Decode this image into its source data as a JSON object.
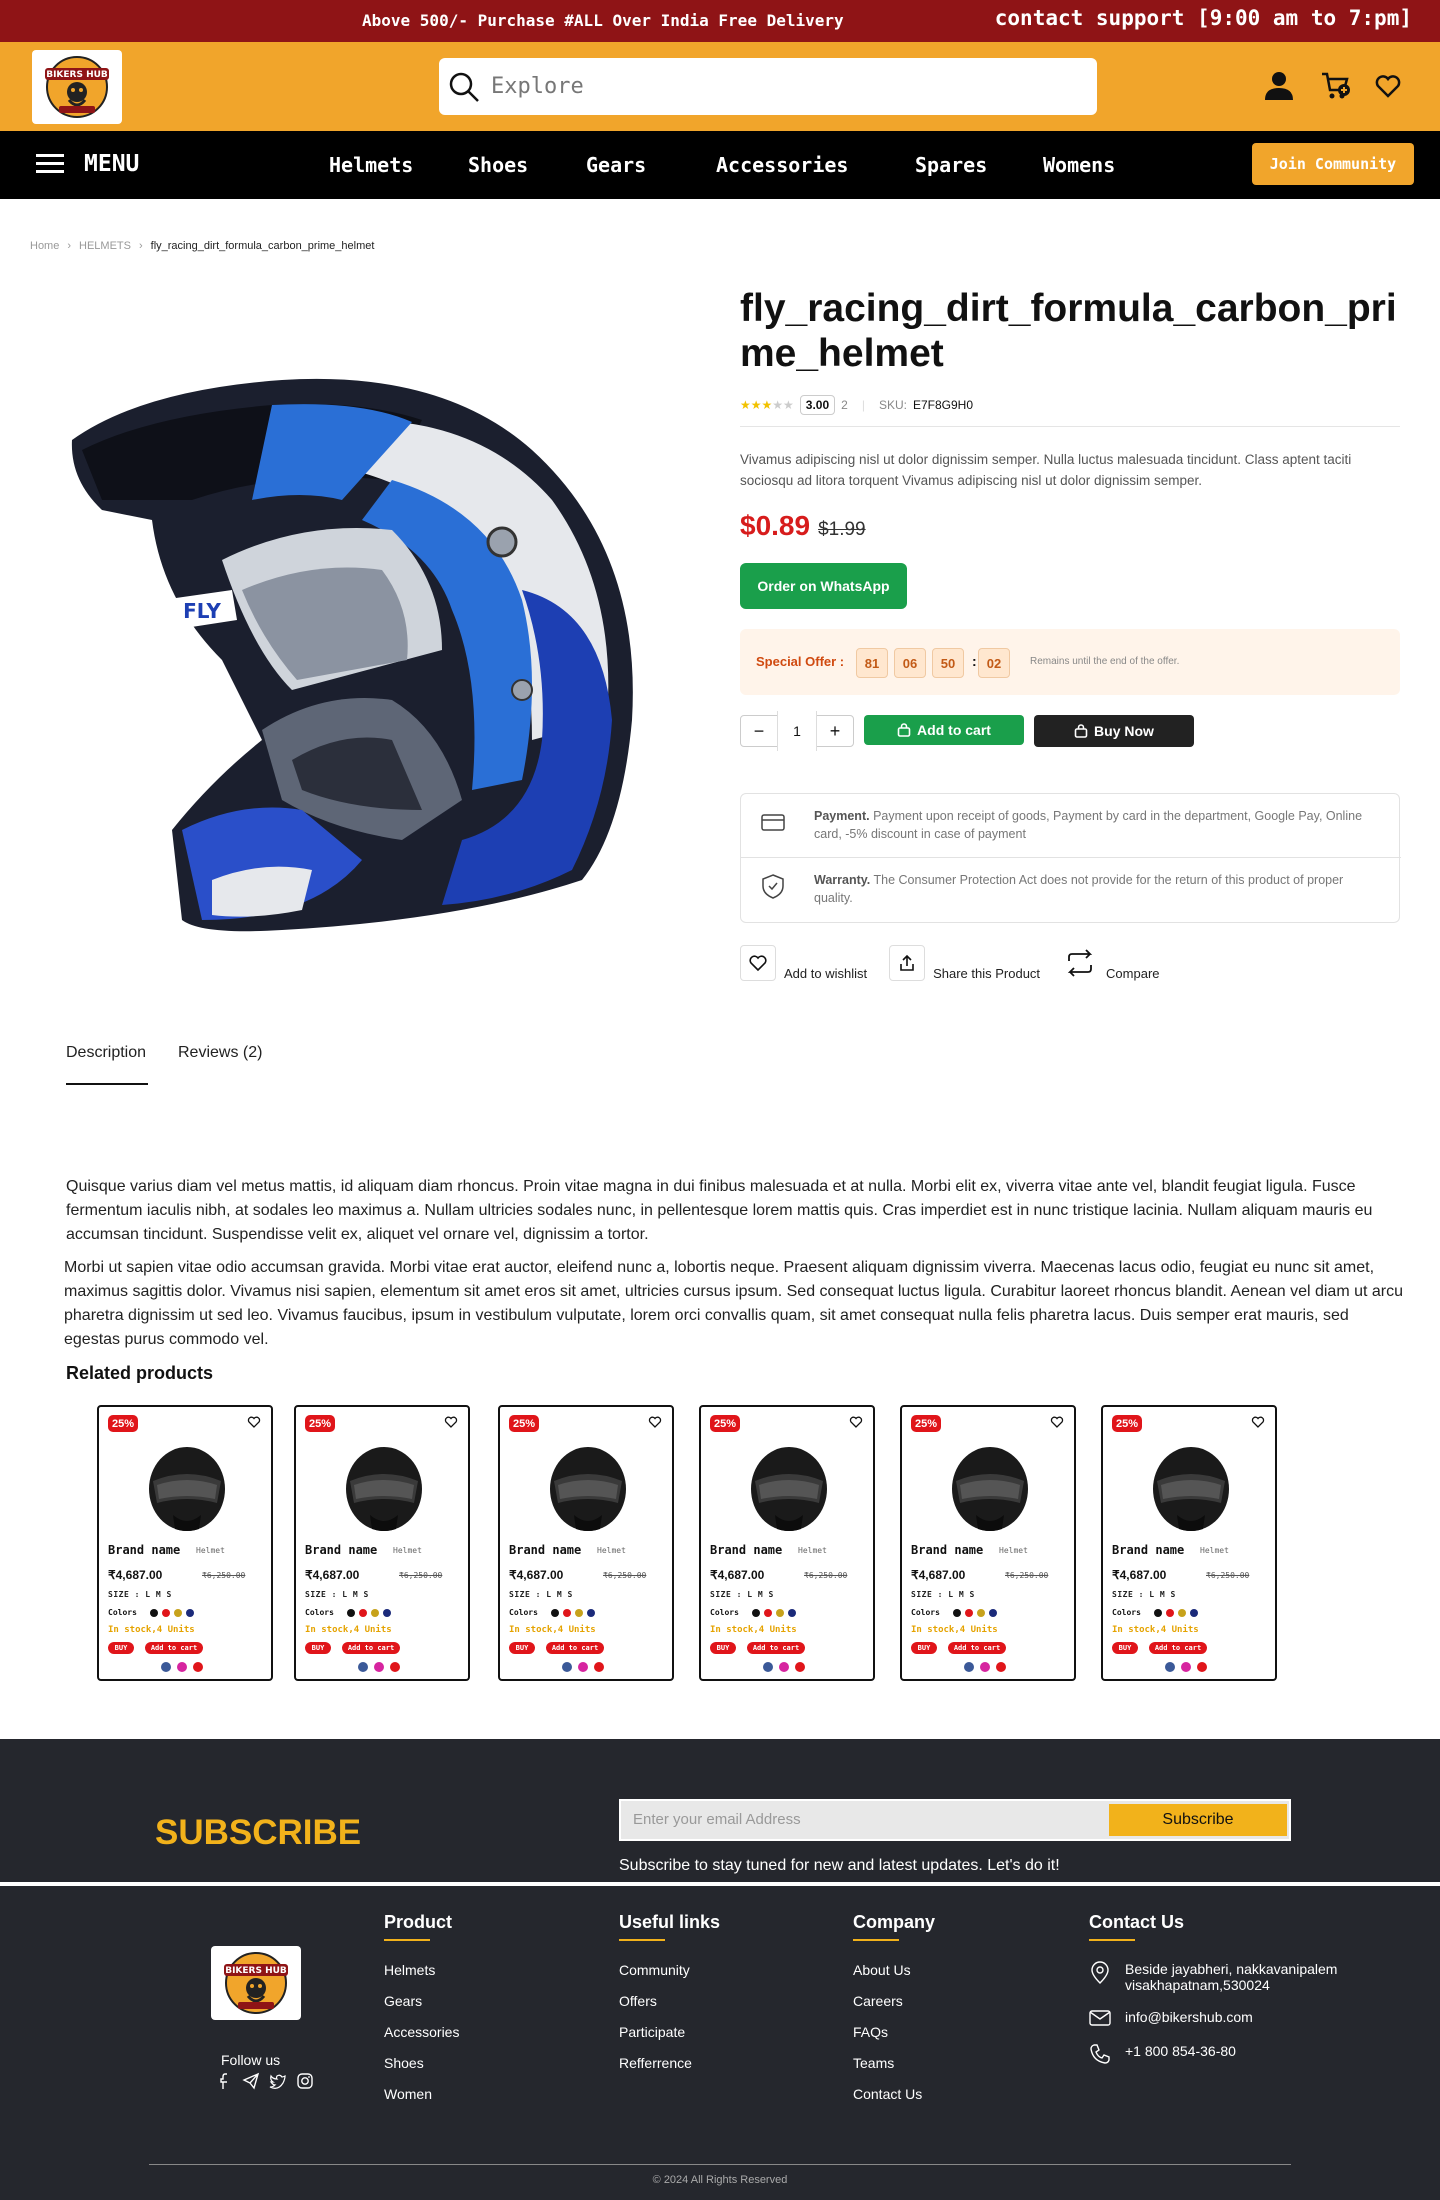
{
  "topbar": {
    "promo": "Above 500/- Purchase  #ALL Over India Free Delivery",
    "support": "contact support [9:00 am to 7:pm]"
  },
  "header": {
    "logo_text": "BIKERS HUB",
    "search_placeholder": "Explore",
    "icons": [
      "user-icon",
      "cart-icon",
      "heart-icon"
    ]
  },
  "nav": {
    "menu_label": "MENU",
    "links": [
      "Helmets",
      "Shoes",
      "Gears",
      "Accessories",
      "Spares",
      "Womens"
    ],
    "join_label": "Join Community"
  },
  "breadcrumb": [
    "Home",
    "HELMETS",
    "fly_racing_dirt_formula_carbon_prime_helmet"
  ],
  "product": {
    "title": "fly_racing_dirt_formula_carbon_prime_helmet",
    "rating_stars": 3,
    "rating_value": "3.00",
    "review_count": "2",
    "sku_label": "SKU:",
    "sku": "E7F8G9H0",
    "description": "Vivamus adipiscing nisl ut dolor dignissim semper. Nulla luctus malesuada tincidunt. Class aptent taciti sociosqu ad litora torquent Vivamus adipiscing nisl ut dolor dignissim semper.",
    "price": "$0.89",
    "old_price": "$1.99",
    "whatsapp_label": "Order on WhatsApp",
    "offer": {
      "label": "Special Offer :",
      "timer": [
        "81",
        "06",
        "50",
        "02"
      ],
      "remains": "Remains until the end of the offer."
    },
    "quantity": "1",
    "add_to_cart": "Add to cart",
    "buy_now": "Buy Now",
    "payment_title": "Payment.",
    "payment_text": "Payment upon receipt of goods, Payment by card in the department, Google Pay, Online card, -5% discount in case of payment",
    "warranty_title": "Warranty.",
    "warranty_text": "The Consumer Protection Act does not provide for the return of this product of proper quality.",
    "actions": [
      "Add to wishlist",
      "Share this Product",
      "Compare"
    ]
  },
  "tabs": [
    "Description",
    "Reviews (2)"
  ],
  "description": {
    "p1": "Quisque varius diam vel metus mattis, id aliquam diam rhoncus. Proin vitae magna in dui finibus malesuada et at nulla. Morbi elit ex, viverra vitae ante vel, blandit feugiat ligula. Fusce fermentum iaculis nibh, at sodales leo maximus a. Nullam ultricies sodales nunc, in pellentesque lorem mattis quis. Cras imperdiet est in nunc tristique lacinia. Nullam aliquam mauris eu accumsan tincidunt. Suspendisse velit ex, aliquet vel ornare vel, dignissim a tortor.",
    "p2": "Morbi ut sapien vitae odio accumsan gravida. Morbi vitae erat auctor, eleifend nunc a, lobortis neque. Praesent aliquam dignissim viverra. Maecenas lacus odio, feugiat eu nunc sit amet, maximus sagittis dolor. Vivamus nisi sapien, elementum sit amet eros sit amet, ultricies cursus ipsum. Sed consequat luctus ligula. Curabitur laoreet rhoncus blandit. Aenean vel diam ut arcu pharetra dignissim ut sed leo. Vivamus faucibus, ipsum in vestibulum vulputate, lorem orci convallis quam, sit amet consequat nulla felis pharetra lacus. Duis semper erat mauris, sed egestas purus commodo vel."
  },
  "related": {
    "title": "Related products",
    "card": {
      "discount": "25%",
      "brand": "Brand name",
      "category": "Helmet",
      "price": "₹4,687.00",
      "old_price": "₹6,250.00",
      "sizes": "SIZE : L  M  S",
      "colors_label": "Colors",
      "stock": "In stock,4 Units",
      "buy": "BUY",
      "add": "Add to cart"
    },
    "swatches": [
      "#111111",
      "#e0151a",
      "#c7a21b",
      "#1b2a7a"
    ]
  },
  "subscribe": {
    "heading": "SUBSCRIBE",
    "placeholder": "Enter your email Address",
    "button": "Subscribe",
    "note": "Subscribe to stay tuned for new and latest updates. Let's do it!"
  },
  "footer": {
    "follow": "Follow us",
    "product": {
      "title": "Product",
      "links": [
        "Helmets",
        "Gears",
        "Accessories",
        "Shoes",
        "Women"
      ]
    },
    "useful": {
      "title": "Useful links",
      "links": [
        "Community",
        "Offers",
        "Participate",
        "Refferrence"
      ]
    },
    "company": {
      "title": "Company",
      "links": [
        "About Us",
        "Careers",
        "FAQs",
        "Teams",
        "Contact Us"
      ]
    },
    "contact": {
      "title": "Contact Us",
      "address": "Beside jayabheri, nakkavanipalem visakhapatnam,530024",
      "email": "info@bikershub.com",
      "phone": "+1 800 854-36-80"
    },
    "copyright": "© 2024 All Rights Reserved"
  },
  "colors": {
    "topbar": "#8f1416",
    "header": "#f1a52b",
    "accent": "#f2b21b",
    "green": "#1a9f4b",
    "red": "#d71c1c",
    "footer": "#25272d"
  }
}
